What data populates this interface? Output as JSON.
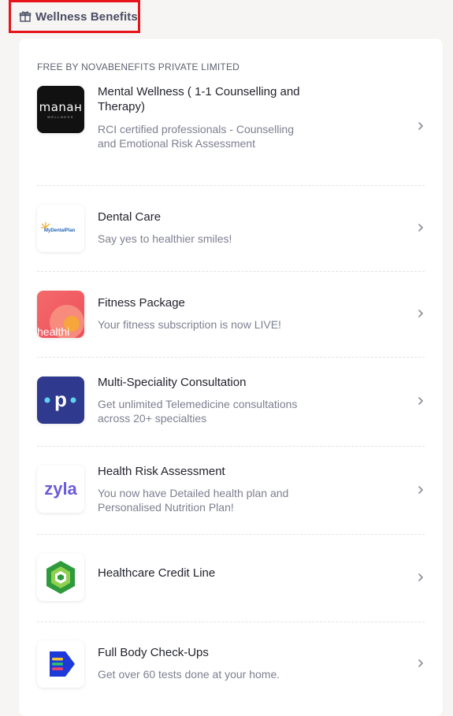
{
  "header": {
    "title": "Wellness Benefits",
    "icon": "gift-box-icon"
  },
  "section_label": "FREE BY NOVABENEFITS PRIVATE LIMITED",
  "items": [
    {
      "title": "Mental Wellness ( 1-1 Counselling and Therapy)",
      "description": "RCI certified professionals - Counselling and Emotional Risk Assessment",
      "logo_text": "manaн",
      "logo_subtext": "WELLNESS"
    },
    {
      "title": "Dental Care",
      "description": "Say yes to healthier smiles!",
      "logo_text": "MyDentalPlan"
    },
    {
      "title": "Fitness Package",
      "description": "Your fitness subscription is now LIVE!",
      "logo_text": "healthi"
    },
    {
      "title": "Multi-Speciality Consultation",
      "description": "Get unlimited Telemedicine consultations across 20+ specialties",
      "logo_text": "p"
    },
    {
      "title": "Health Risk Assessment",
      "description": "You now have Detailed health plan and Personalised Nutrition Plan!",
      "logo_text": "zyla"
    },
    {
      "title": "Healthcare Credit Line",
      "description": ""
    },
    {
      "title": "Full Body Check-Ups",
      "description": "Get over 60 tests done at your home."
    }
  ],
  "colors": {
    "accent_red": "#e8141b",
    "zyla": "#6a5bd9",
    "pace": "#2f3a8f",
    "manah_bg": "#111111"
  }
}
